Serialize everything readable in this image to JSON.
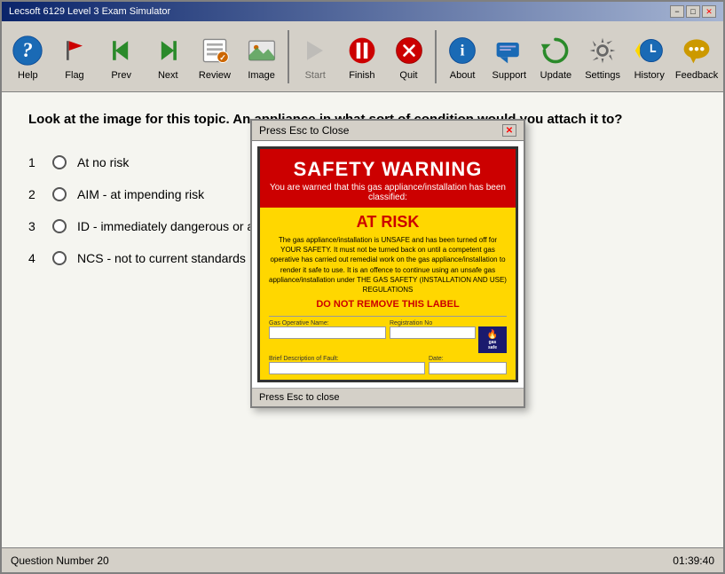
{
  "window": {
    "title": "Lecsoft 6129 Level 3 Exam Simulator",
    "titlebar_buttons": [
      "−",
      "□",
      "✕"
    ]
  },
  "toolbar": {
    "items": [
      {
        "id": "help",
        "label": "Help",
        "icon": "help-icon"
      },
      {
        "id": "flag",
        "label": "Flag",
        "icon": "flag-icon"
      },
      {
        "id": "prev",
        "label": "Prev",
        "icon": "prev-icon"
      },
      {
        "id": "next",
        "label": "Next",
        "icon": "next-icon"
      },
      {
        "id": "review",
        "label": "Review",
        "icon": "review-icon"
      },
      {
        "id": "image",
        "label": "Image",
        "icon": "image-icon"
      },
      {
        "id": "start",
        "label": "Start",
        "icon": "start-icon"
      },
      {
        "id": "finish",
        "label": "Finish",
        "icon": "finish-icon"
      },
      {
        "id": "quit",
        "label": "Quit",
        "icon": "quit-icon"
      },
      {
        "id": "about",
        "label": "About",
        "icon": "about-icon"
      },
      {
        "id": "support",
        "label": "Support",
        "icon": "support-icon"
      },
      {
        "id": "update",
        "label": "Update",
        "icon": "update-icon"
      },
      {
        "id": "settings",
        "label": "Settings",
        "icon": "settings-icon"
      },
      {
        "id": "history",
        "label": "History",
        "icon": "history-icon"
      },
      {
        "id": "feedback",
        "label": "Feedback",
        "icon": "feedback-icon"
      }
    ]
  },
  "question": {
    "text": "Look at the image for this topic. An appliance in what sort of condition would you attach it to?",
    "answers": [
      {
        "num": "1",
        "text": "At no risk"
      },
      {
        "num": "2",
        "text": "AIM - at impending risk"
      },
      {
        "num": "3",
        "text": "ID - immediately dangerous or at risk"
      },
      {
        "num": "4",
        "text": "NCS - not to current standards"
      }
    ]
  },
  "modal": {
    "title": "Press Esc to Close",
    "close_btn": "✕",
    "footer": "Press Esc to close",
    "safety_label": {
      "warning_title": "SAFETY WARNING",
      "subtitle": "You are warned that this gas appliance/installation has been classified:",
      "at_risk": "AT RISK",
      "body_text": "The gas appliance/installation is UNSAFE and has been turned off for YOUR SAFETY. It must not be turned back on until a competent gas operative has carried out remedial work on the gas appliance/installation to render it safe to use. It is an offence to continue using an unsafe gas appliance/installation under THE GAS SAFETY (INSTALLATION AND USE) REGULATIONS",
      "do_not": "DO NOT REMOVE THIS LABEL",
      "field1_label": "Gas Operative Name:",
      "field2_label": "Registration No",
      "field3_label": "Brief Description of Fault:",
      "field4_label": "Date:"
    }
  },
  "statusbar": {
    "question_number": "Question Number 20",
    "timer": "01:39:40"
  }
}
